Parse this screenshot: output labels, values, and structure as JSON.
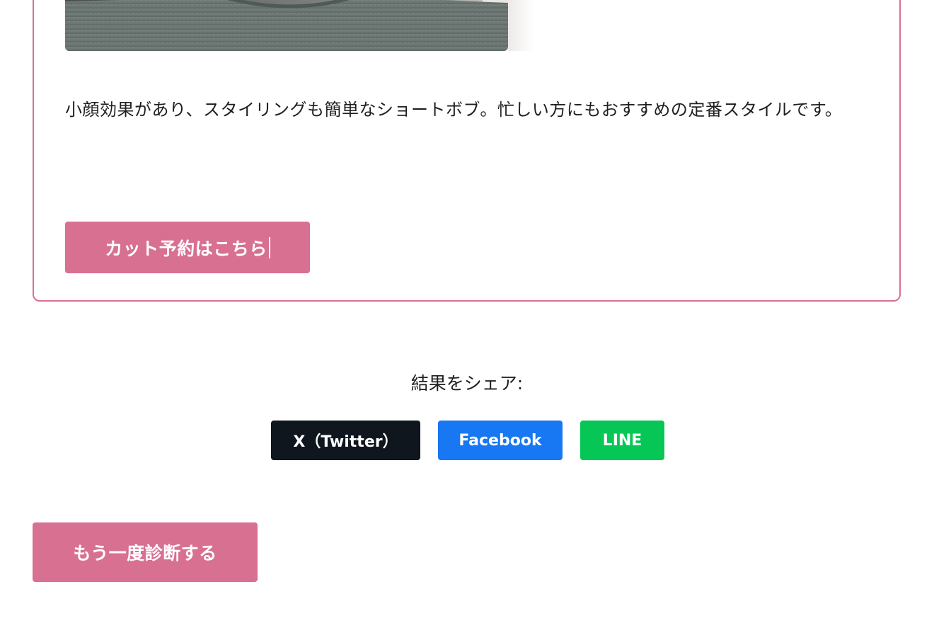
{
  "result": {
    "photo_alt": "ショートボブのヘアスタイル",
    "description": "小顔効果があり、スタイリングも簡単なショートボブ。忙しい方にもおすすめの定番スタイルです。",
    "reserve_label": "カット予約はこちら"
  },
  "share": {
    "heading": "結果をシェア:",
    "buttons": [
      {
        "label": "X（Twitter）",
        "color": "#10161e"
      },
      {
        "label": "Facebook",
        "color": "#1877f2"
      },
      {
        "label": "LINE",
        "color": "#06c755"
      }
    ]
  },
  "retry": {
    "label": "もう一度診断する"
  },
  "colors": {
    "accent": "#d87092",
    "text": "#1f1f1f",
    "background": "#ffffff"
  }
}
